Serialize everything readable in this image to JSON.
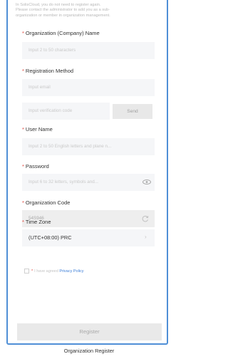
{
  "notice": {
    "line1": "In SolisCloud, you do not need to register again.",
    "line2": "Please contact the administrator to add you as a sub-",
    "line3": "organization or member in organization management."
  },
  "fields": {
    "org_name": {
      "label": "Organization (Company) Name",
      "placeholder": "Input 2 to 50 characters"
    },
    "reg_method": {
      "label": "Registration Method",
      "placeholder": "Input email"
    },
    "verification": {
      "placeholder": "Input verification code",
      "send_label": "Send"
    },
    "user_name": {
      "label": "User Name",
      "placeholder": "Input 2 to 50 English letters and plane n..."
    },
    "password": {
      "label": "Password",
      "placeholder": "Input 6 to 32 letters, symbols and..."
    },
    "org_code": {
      "label": "Organization Code",
      "value": "54S946"
    },
    "time_zone": {
      "label": "Time Zone",
      "value": "(UTC+08:00) PRC"
    }
  },
  "agreement": {
    "prefix": "I have agreed",
    "link": "Privacy Policy"
  },
  "register_label": "Register",
  "caption": "Organization Register",
  "colors": {
    "accent": "#4f8fd6",
    "required": "#e0483e",
    "link": "#3d7fd8"
  }
}
